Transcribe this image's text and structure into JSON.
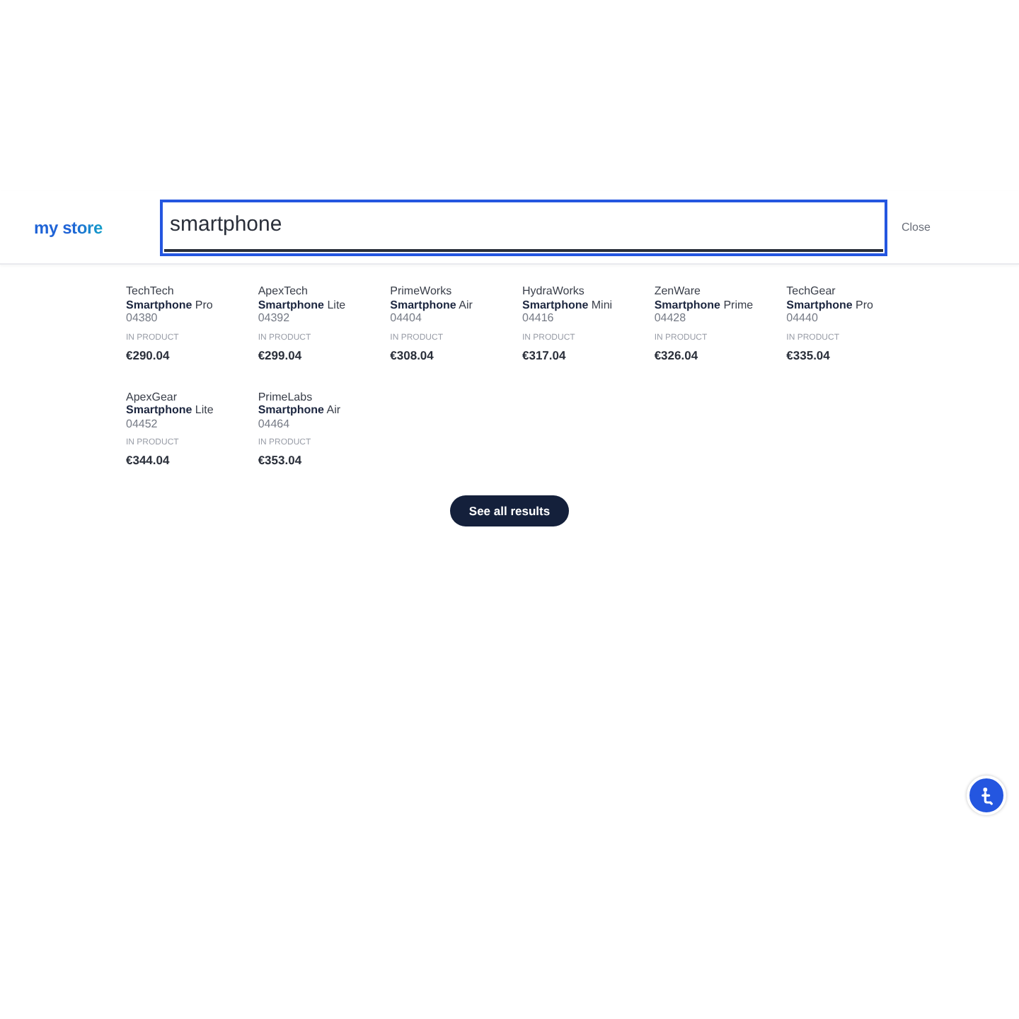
{
  "logo": {
    "text": "my store"
  },
  "search": {
    "value": "smartphone",
    "focused": true
  },
  "close_link": "Close",
  "products": [
    {
      "brand": "TechTech",
      "name": "**Smartphone** Pro",
      "code": "04380",
      "label": "IN PRODUCT",
      "price": "€290.04"
    },
    {
      "brand": "ApexTech",
      "name": "**Smartphone** Lite",
      "code": "04392",
      "label": "IN PRODUCT",
      "price": "€299.04"
    },
    {
      "brand": "PrimeWorks",
      "name": "**Smartphone** Air",
      "code": "04404",
      "label": "IN PRODUCT",
      "price": "€308.04"
    },
    {
      "brand": "HydraWorks",
      "name": "**Smartphone** Mini",
      "code": "04416",
      "label": "IN PRODUCT",
      "price": "€317.04"
    },
    {
      "brand": "ZenWare",
      "name": "**Smartphone** Prime",
      "code": "04428",
      "label": "IN PRODUCT",
      "price": "€326.04"
    },
    {
      "brand": "TechGear",
      "name": "**Smartphone** Pro",
      "code": "04440",
      "label": "IN PRODUCT",
      "price": "€335.04"
    },
    {
      "brand": "ApexGear",
      "name": "**Smartphone** Lite",
      "code": "04452",
      "label": "IN PRODUCT",
      "price": "€344.04"
    },
    {
      "brand": "PrimeLabs",
      "name": "**Smartphone** Air",
      "code": "04464",
      "label": "IN PRODUCT",
      "price": "€353.04"
    }
  ],
  "see_all_button": "See all results"
}
